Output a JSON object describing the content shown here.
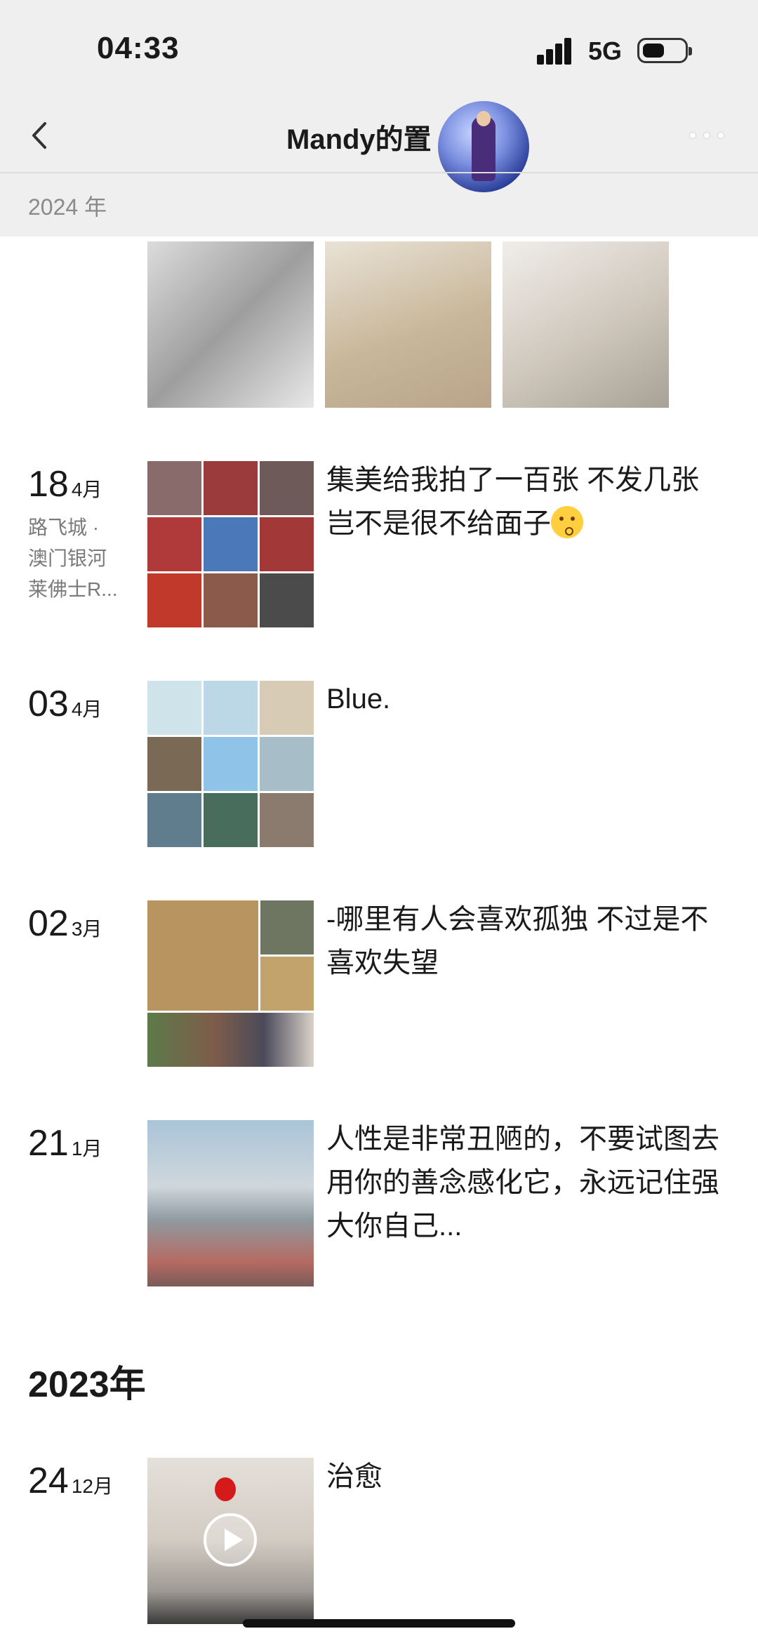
{
  "status_bar": {
    "time": "04:33",
    "network": "5G"
  },
  "nav": {
    "title": "Mandy的置",
    "icons": [
      "back-chevron-icon",
      "more-dots-icon"
    ]
  },
  "sticky_year": "2024 年",
  "posts": [
    {
      "day": "18",
      "month": "4月",
      "location_lines": [
        "路飞城 ·",
        "澳门银河",
        "莱佛士R..."
      ],
      "text": "集美给我拍了一百张 不发几张岂不是很不给面子",
      "emoji": "kissing-face-emoji"
    },
    {
      "day": "03",
      "month": "4月",
      "text": "Blue."
    },
    {
      "day": "02",
      "month": "3月",
      "text": "-哪里有人会喜欢孤独 不过是不喜欢失望"
    },
    {
      "day": "21",
      "month": "1月",
      "text": "人性是非常丑陋的，不要试图去用你的善念感化它，永远记住强大你自己..."
    }
  ],
  "year_2023": "2023年",
  "post_2023": {
    "day": "24",
    "month": "12月",
    "text": "治愈",
    "media": "video"
  },
  "colors": {
    "header_bg": "#efefef",
    "sticky_year_text": "#8a8a8a",
    "body_bg": "#ffffff"
  }
}
